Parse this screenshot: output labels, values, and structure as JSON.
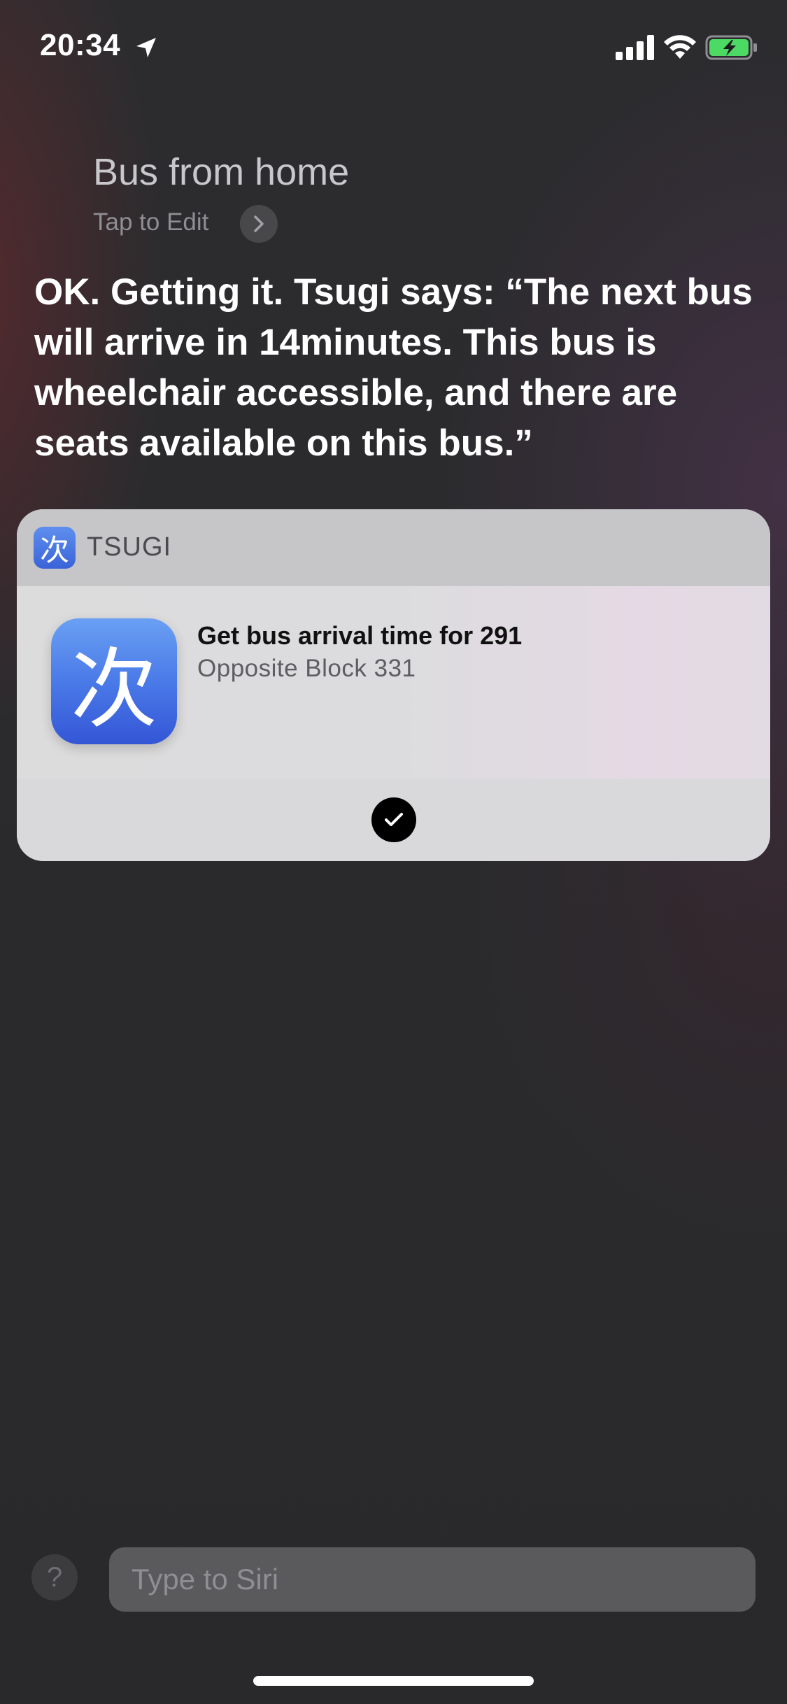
{
  "status_bar": {
    "time": "20:34",
    "icons": [
      "location-arrow-icon",
      "cellular-signal-icon",
      "wifi-icon",
      "battery-charging-icon"
    ],
    "battery_color": "#4cd964"
  },
  "query": {
    "text": "Bus from home",
    "edit_label": "Tap to Edit"
  },
  "response": {
    "text": "OK. Getting it. Tsugi says: “The next bus will arrive in 14minutes. This bus is wheelchair accessible, and there are seats available on this bus.”"
  },
  "card": {
    "app_glyph": "次",
    "app_name": "TSUGI",
    "shortcut_title": "Get bus arrival time for 291",
    "shortcut_subtitle": "Opposite Block 331",
    "app_icon_color": "#4a7ae8",
    "confirm_icon": "checkmark-icon"
  },
  "bottom": {
    "help_glyph": "?",
    "input_placeholder": "Type to Siri"
  }
}
